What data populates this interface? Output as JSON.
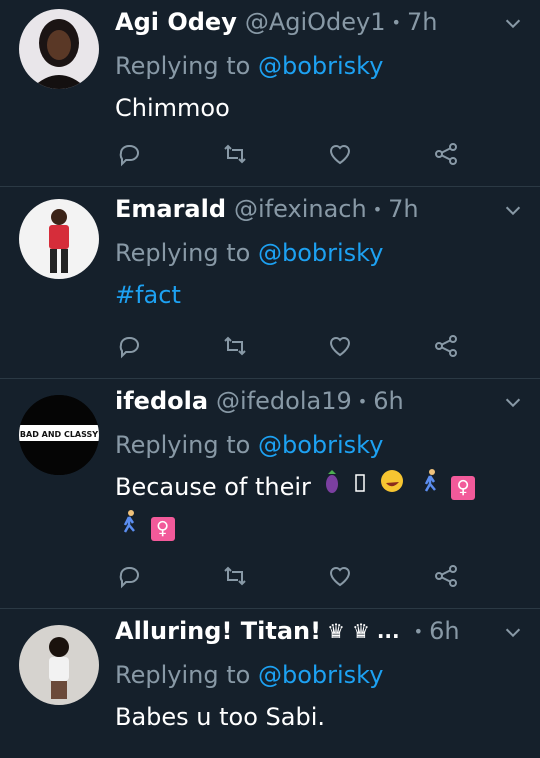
{
  "tweets": [
    {
      "name": "Agi Odey",
      "handle": "@AgiOdey1",
      "time": "7h",
      "replying_prefix": "Replying to",
      "replying_to": "@bobrisky",
      "text": "Chimmoo"
    },
    {
      "name": "Emarald",
      "handle": "@ifexinach",
      "time": "7h",
      "replying_prefix": "Replying to",
      "replying_to": "@bobrisky",
      "text": "#fact"
    },
    {
      "name": "ifedola",
      "handle": "@ifedola19",
      "time": "6h",
      "replying_prefix": "Replying to",
      "replying_to": "@bobrisky",
      "text": "Because of their",
      "avatar_text": "BAD AND CLASSY",
      "emojis": [
        "eggplant-emoji",
        "missing-glyph",
        "rofl-emoji",
        "running-emoji",
        "female-sign-emoji",
        "running-emoji",
        "female-sign-emoji"
      ]
    },
    {
      "name": "Alluring! Titan!",
      "name_suffix": "♛ ♛ ...",
      "time": "6h",
      "replying_prefix": "Replying to",
      "replying_to": "@bobrisky",
      "text": "Babes u too Sabi."
    }
  ],
  "colors": {
    "background": "#15202b",
    "secondary_text": "#8899a6",
    "link": "#1da1f2",
    "divider": "#2b3944"
  }
}
